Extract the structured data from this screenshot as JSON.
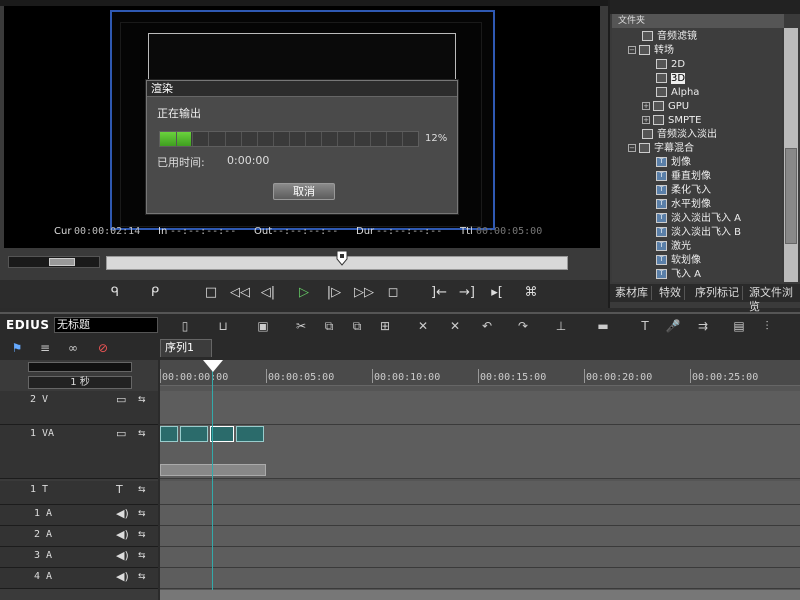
{
  "render_dialog": {
    "title": "渲染",
    "status": "正在输出",
    "progress_fraction": 0.12,
    "progress_text": "12%",
    "elapsed_label": "已用时间:",
    "elapsed_value": "0:00:00",
    "cancel_label": "取消"
  },
  "timecodes": {
    "cur_label": "Cur",
    "cur_value": "00:00:02:14",
    "in_label": "In",
    "in_value": "--:--:--:--",
    "out_label": "Out",
    "out_value": "--:--:--:--",
    "dur_label": "Dur",
    "dur_value": "--:--:--:--",
    "ttl_label": "Ttl",
    "ttl_value": "00:00:05:00"
  },
  "library": {
    "folder_label": "文件夹",
    "tree": [
      {
        "label": "音频滤镜",
        "icon": "folder-fx-icon",
        "level": 1,
        "expand": ""
      },
      {
        "label": "转场",
        "icon": "folder-open-icon",
        "level": 1,
        "expand": "−"
      },
      {
        "label": "2D",
        "icon": "transition-icon",
        "level": 2,
        "expand": ""
      },
      {
        "label": "3D",
        "icon": "transition-icon",
        "level": 2,
        "expand": "",
        "selected": true
      },
      {
        "label": "Alpha",
        "icon": "transition-icon",
        "level": 2,
        "expand": ""
      },
      {
        "label": "GPU",
        "icon": "transition-icon",
        "level": 2,
        "expand": "+"
      },
      {
        "label": "SMPTE",
        "icon": "transition-icon",
        "level": 2,
        "expand": "+"
      },
      {
        "label": "音频淡入淡出",
        "icon": "folder-fx-icon",
        "level": 1,
        "expand": ""
      },
      {
        "label": "字幕混合",
        "icon": "folder-open-icon",
        "level": 1,
        "expand": "−"
      },
      {
        "label": "划像",
        "icon": "title-icon",
        "level": 2,
        "expand": ""
      },
      {
        "label": "垂直划像",
        "icon": "title-icon",
        "level": 2,
        "expand": ""
      },
      {
        "label": "柔化飞入",
        "icon": "title-icon",
        "level": 2,
        "expand": ""
      },
      {
        "label": "水平划像",
        "icon": "title-icon",
        "level": 2,
        "expand": ""
      },
      {
        "label": "淡入淡出飞入 A",
        "icon": "title-icon",
        "level": 2,
        "expand": ""
      },
      {
        "label": "淡入淡出飞入 B",
        "icon": "title-icon",
        "level": 2,
        "expand": ""
      },
      {
        "label": "激光",
        "icon": "title-icon",
        "level": 2,
        "expand": ""
      },
      {
        "label": "软划像",
        "icon": "title-icon",
        "level": 2,
        "expand": ""
      },
      {
        "label": "飞入 A",
        "icon": "title-icon",
        "level": 2,
        "expand": ""
      }
    ],
    "tabs": [
      "素材库",
      "特效",
      "序列标记",
      "源文件浏览"
    ]
  },
  "timeline": {
    "app_logo": "EDIUS",
    "project_name": "无标题",
    "sequence_tab": "序列1",
    "scale_label": "1 秒",
    "ruler_ticks": [
      "00:00:00:00",
      "00:00:05:00",
      "00:00:10:00",
      "00:00:15:00",
      "00:00:20:00",
      "00:00:25:00"
    ],
    "tracks": [
      {
        "name": "2 V"
      },
      {
        "name": "1 VA"
      },
      {
        "name": "1 T"
      },
      {
        "name": "1 A"
      },
      {
        "name": "2 A"
      },
      {
        "name": "3 A"
      },
      {
        "name": "4 A"
      }
    ]
  }
}
